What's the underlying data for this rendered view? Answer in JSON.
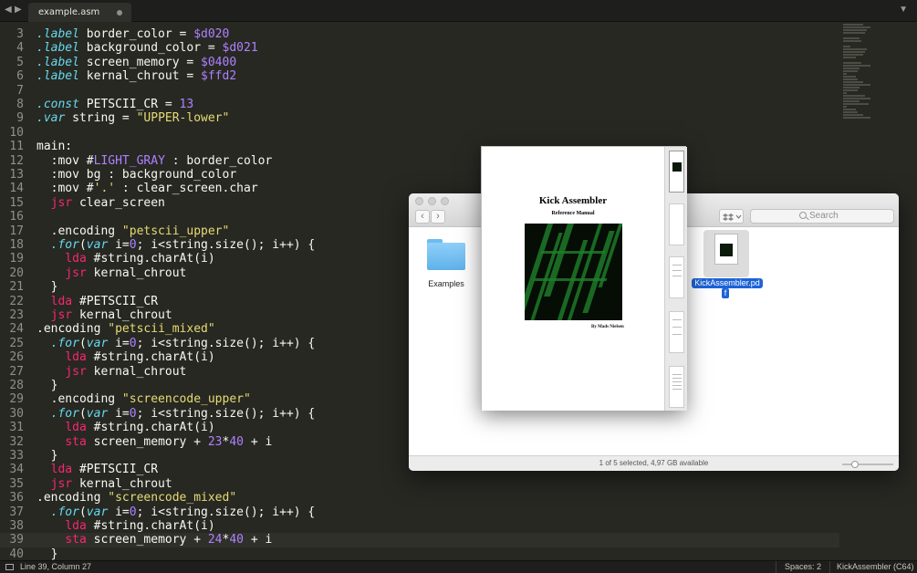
{
  "tabbar": {
    "back": "◀",
    "forward": "▶",
    "tab_name": "example.asm",
    "dropdown": "▼"
  },
  "editor": {
    "lines": [
      {
        "n": "3",
        "html": "<span class=\"k\">.label</span> border_color = <span class=\"n\">$d020</span>"
      },
      {
        "n": "4",
        "html": "<span class=\"k\">.label</span> background_color = <span class=\"n\">$d021</span>"
      },
      {
        "n": "5",
        "html": "<span class=\"k\">.label</span> screen_memory = <span class=\"n\">$0400</span>"
      },
      {
        "n": "6",
        "html": "<span class=\"k\">.label</span> kernal_chrout = <span class=\"n\">$ffd2</span>"
      },
      {
        "n": "7",
        "html": ""
      },
      {
        "n": "8",
        "html": "<span class=\"k\">.const</span> PETSCII_CR = <span class=\"n\">13</span>"
      },
      {
        "n": "9",
        "html": "<span class=\"k\">.var</span> string = <span class=\"s\">\"UPPER-lower\"</span>"
      },
      {
        "n": "10",
        "html": ""
      },
      {
        "n": "11",
        "html": "main:"
      },
      {
        "n": "12",
        "html": "  :mov #<span class=\"n\">LIGHT_GRAY</span> : border_color"
      },
      {
        "n": "13",
        "html": "  :mov bg : background_color"
      },
      {
        "n": "14",
        "html": "  :mov #<span class=\"s\">'.'</span> : clear_screen.char"
      },
      {
        "n": "15",
        "html": "  <span class=\"r\">jsr</span> clear_screen"
      },
      {
        "n": "16",
        "html": ""
      },
      {
        "n": "17",
        "html": "  .encoding <span class=\"s\">\"petscii_upper\"</span>"
      },
      {
        "n": "18",
        "html": "  <span class=\"k\">.for</span>(<span class=\"k\">var</span> i=<span class=\"n\">0</span>; i&lt;string.size(); i++) {"
      },
      {
        "n": "19",
        "html": "    <span class=\"r\">lda</span> #string.charAt(i)"
      },
      {
        "n": "20",
        "html": "    <span class=\"r\">jsr</span> kernal_chrout"
      },
      {
        "n": "21",
        "html": "  }"
      },
      {
        "n": "22",
        "html": "  <span class=\"r\">lda</span> #PETSCII_CR"
      },
      {
        "n": "23",
        "html": "  <span class=\"r\">jsr</span> kernal_chrout"
      },
      {
        "n": "24",
        "html": ".encoding <span class=\"s\">\"petscii_mixed\"</span>"
      },
      {
        "n": "25",
        "html": "  <span class=\"k\">.for</span>(<span class=\"k\">var</span> i=<span class=\"n\">0</span>; i&lt;string.size(); i++) {"
      },
      {
        "n": "26",
        "html": "    <span class=\"r\">lda</span> #string.charAt(i)"
      },
      {
        "n": "27",
        "html": "    <span class=\"r\">jsr</span> kernal_chrout"
      },
      {
        "n": "28",
        "html": "  }"
      },
      {
        "n": "29",
        "html": "  .encoding <span class=\"s\">\"screencode_upper\"</span>"
      },
      {
        "n": "30",
        "html": "  <span class=\"k\">.for</span>(<span class=\"k\">var</span> i=<span class=\"n\">0</span>; i&lt;string.size(); i++) {"
      },
      {
        "n": "31",
        "html": "    <span class=\"r\">lda</span> #string.charAt(i)"
      },
      {
        "n": "32",
        "html": "    <span class=\"r\">sta</span> screen_memory + <span class=\"n\">23</span>*<span class=\"n\">40</span> + i"
      },
      {
        "n": "33",
        "html": "  }"
      },
      {
        "n": "34",
        "html": "  <span class=\"r\">lda</span> #PETSCII_CR"
      },
      {
        "n": "35",
        "html": "  <span class=\"r\">jsr</span> kernal_chrout"
      },
      {
        "n": "36",
        "html": ".encoding <span class=\"s\">\"screencode_mixed\"</span>"
      },
      {
        "n": "37",
        "html": "  <span class=\"k\">.for</span>(<span class=\"k\">var</span> i=<span class=\"n\">0</span>; i&lt;string.size(); i++) {"
      },
      {
        "n": "38",
        "html": "    <span class=\"r\">lda</span> #string.charAt(i)"
      },
      {
        "n": "39",
        "html": "    <span class=\"r\">sta</span> screen_memory + <span class=\"n\">24</span>*<span class=\"n\">40</span> + i"
      },
      {
        "n": "40",
        "html": "  }"
      }
    ],
    "current_line": "39"
  },
  "statusbar": {
    "position": "Line 39, Column 27",
    "spaces": "Spaces: 2",
    "syntax": "KickAssembler (C64)"
  },
  "finder": {
    "title_fragment": "r",
    "back": "‹",
    "forward": "›",
    "search_placeholder": "Search",
    "folder_label": "Examples",
    "file_label_line1": "KickAssembler.pd",
    "file_label_line2": "f",
    "status": "1 of 5 selected, 4,97 GB available",
    "icon_size_level": 0.2
  },
  "quicklook": {
    "title": "Kick Assembler",
    "subtitle": "Reference Manual",
    "author": "By Mads Nielsen"
  },
  "colors": {
    "background": "#272822",
    "keyword": "#66d9ef",
    "instruction": "#f92672",
    "number": "#ae81ff",
    "string": "#e6db74",
    "selection": "#1d63d6"
  }
}
